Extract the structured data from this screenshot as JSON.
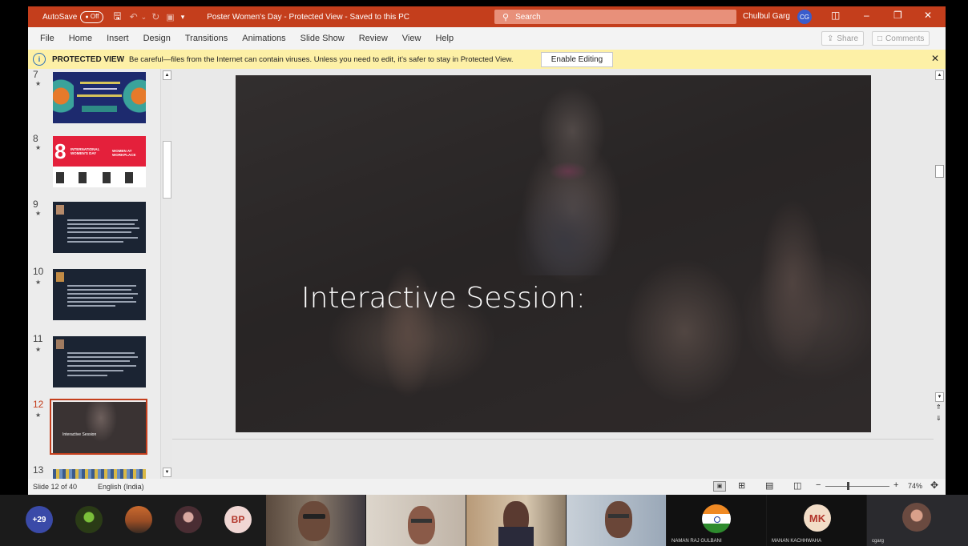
{
  "titlebar": {
    "autosave_label": "AutoSave",
    "autosave_state": "Off",
    "doc_title": "Poster Women's Day  -  Protected View  -  Saved to this PC",
    "search_placeholder": "Search",
    "user_name": "Chulbul Garg",
    "user_initials": "CG"
  },
  "menu": {
    "items": [
      "File",
      "Home",
      "Insert",
      "Design",
      "Transitions",
      "Animations",
      "Slide Show",
      "Review",
      "View",
      "Help"
    ],
    "share_label": "Share",
    "comments_label": "Comments"
  },
  "protected_view": {
    "title": "PROTECTED VIEW",
    "message": "Be careful—files from the Internet can contain viruses. Unless you need to edit, it's safer to stay in Protected View.",
    "enable_label": "Enable Editing"
  },
  "thumbnails": [
    {
      "number": "7"
    },
    {
      "number": "8",
      "big": "8",
      "label1": "INTERNATIONAL WOMEN'S DAY",
      "label2": "WOMEN AT WORKPLACE"
    },
    {
      "number": "9"
    },
    {
      "number": "10"
    },
    {
      "number": "11"
    },
    {
      "number": "12",
      "caption": "Interactive Session",
      "selected": true
    },
    {
      "number": "13"
    }
  ],
  "slide": {
    "title": "Interactive Session:"
  },
  "statusbar": {
    "slide_info": "Slide 12 of 40",
    "language": "English (India)",
    "zoom": "74%",
    "zoom_minus": "−",
    "zoom_plus": "+"
  },
  "meeting": {
    "overflow_count": "+29",
    "participants": [
      {
        "initials": "BP",
        "color": "#f0d7d4"
      },
      {
        "initials": "MK",
        "color": "#f2ddc7"
      }
    ],
    "tile_names": [
      "NAMAN RAJ GULBANI",
      "MANAN KACHHWAHA",
      "cgarg"
    ]
  },
  "colors": {
    "accent": "#c43e1c",
    "protected_bar": "#fdf0a6",
    "selection": "#c43e1c"
  }
}
